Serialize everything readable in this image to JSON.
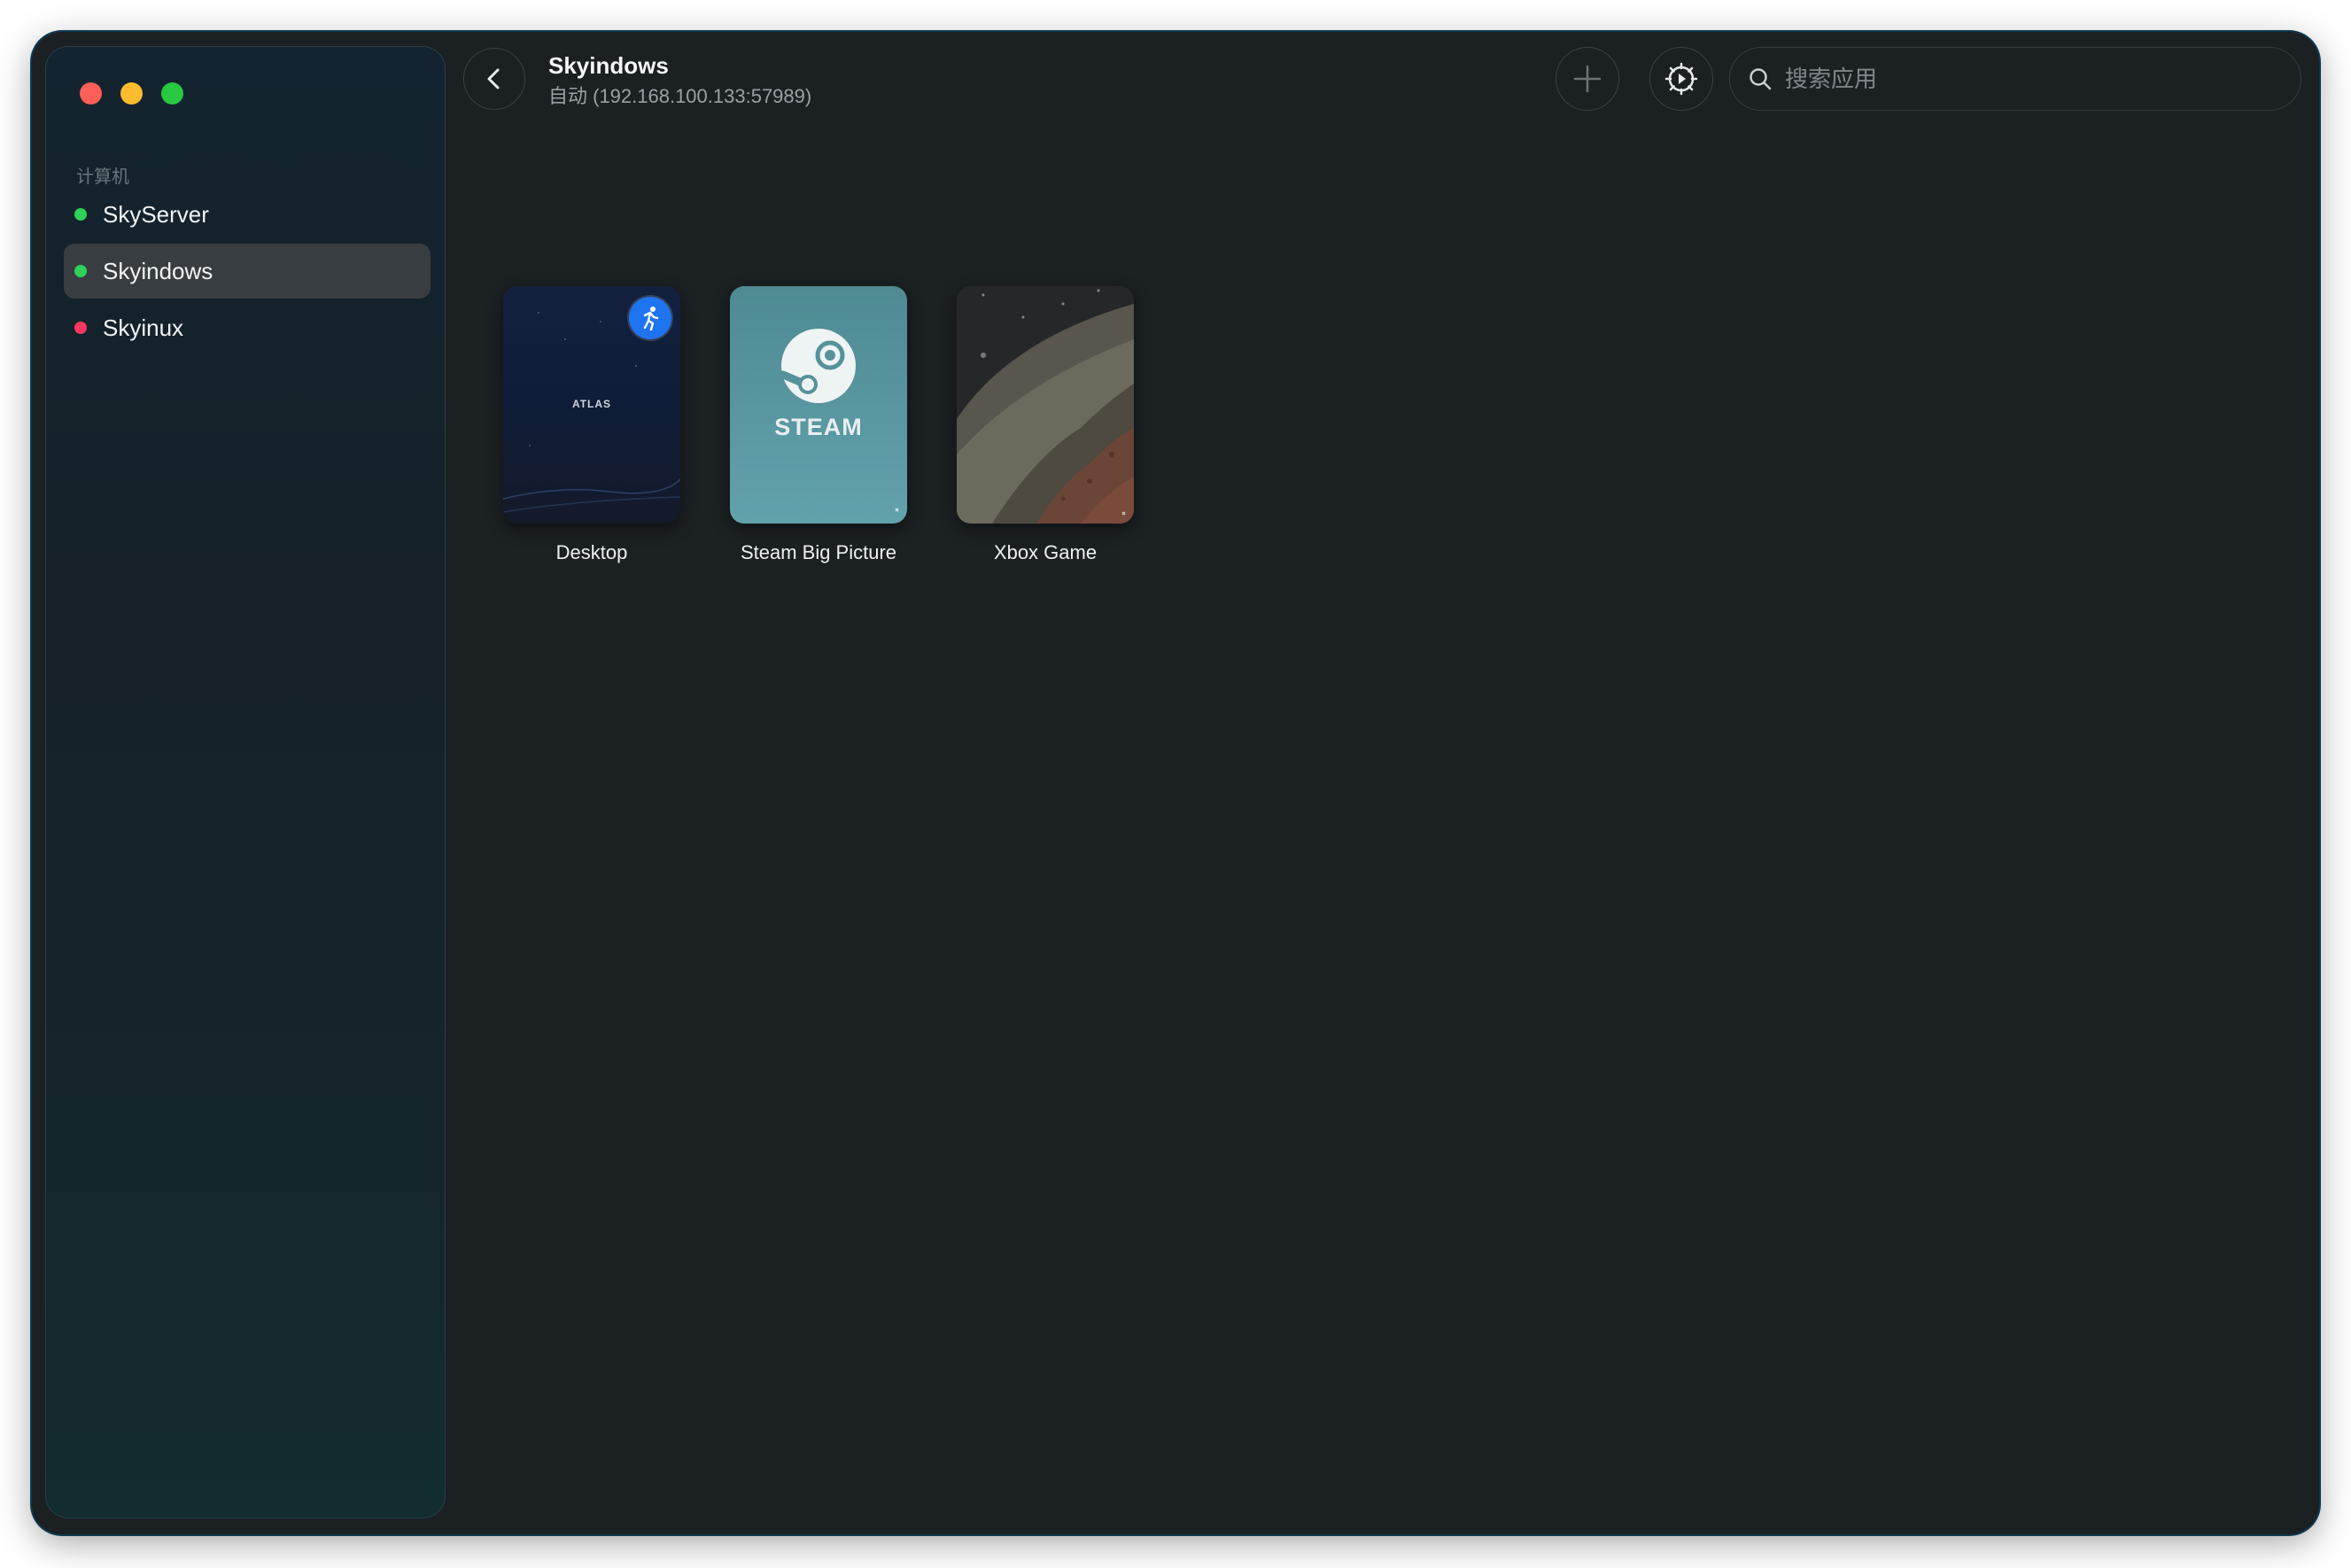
{
  "sidebar": {
    "section_label": "计算机",
    "machines": [
      {
        "label": "SkyServer",
        "status": "online",
        "status_color": "#30d158"
      },
      {
        "label": "Skyindows",
        "status": "online",
        "status_color": "#30d158",
        "selected": true
      },
      {
        "label": "Skyinux",
        "status": "offline",
        "status_color": "#ff375f"
      }
    ]
  },
  "header": {
    "host_name": "Skyindows",
    "host_detail": "自动 (192.168.100.133:57989)",
    "back_icon": "chevron-left-icon",
    "add_icon": "plus-icon",
    "settings_icon": "gear-icon"
  },
  "search": {
    "placeholder": "搜索应用",
    "value": ""
  },
  "apps": [
    {
      "name": "Desktop",
      "thumb_text": "ATLAS",
      "badge_icon": "running-icon"
    },
    {
      "name": "Steam Big Picture",
      "thumb_text": "STEAM"
    },
    {
      "name": "Xbox Game"
    }
  ],
  "colors": {
    "window_bg": "#1b2023",
    "accent_badge": "#1e74f0",
    "online": "#30d158",
    "offline": "#ff375f"
  }
}
